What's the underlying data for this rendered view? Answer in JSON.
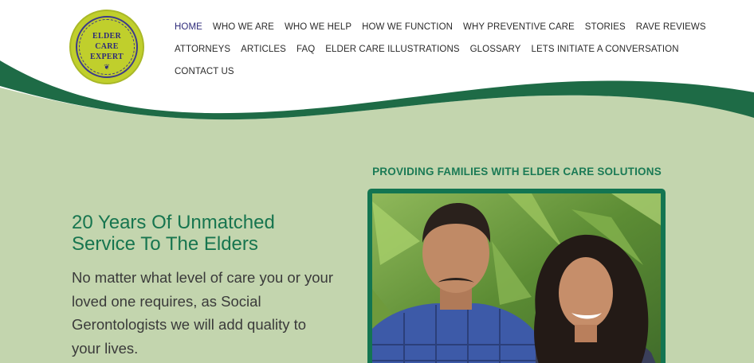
{
  "logo": {
    "line1": "ELDER",
    "line2": "CARE",
    "line3": "EXPERT"
  },
  "nav": {
    "row1": [
      "HOME",
      "WHO WE ARE",
      "WHO WE HELP",
      "HOW WE FUNCTION",
      "WHY PREVENTIVE CARE",
      "STORIES",
      "RAVE REVIEWS"
    ],
    "row2": [
      "ATTORNEYS",
      "ARTICLES",
      "FAQ",
      "ELDER CARE ILLUSTRATIONS",
      "GLOSSARY",
      "LETS INITIATE A CONVERSATION"
    ],
    "row3": [
      "CONTACT US"
    ],
    "active": "HOME"
  },
  "hero": {
    "tagline": "PROVIDING FAMILIES WITH ELDER CARE SOLUTIONS",
    "headline_line1": "20 Years Of Unmatched",
    "headline_line2": "Service To The Elders",
    "body": "No matter what level of care you or your loved one requires, as Social Gerontologists we will add quality to your lives."
  },
  "colors": {
    "background": "#c3d5ae",
    "wave_dark": "#1e6b46",
    "accent_green": "#17754f",
    "logo_yellow": "#c0cf2c",
    "nav_active": "#2e2b7a"
  }
}
